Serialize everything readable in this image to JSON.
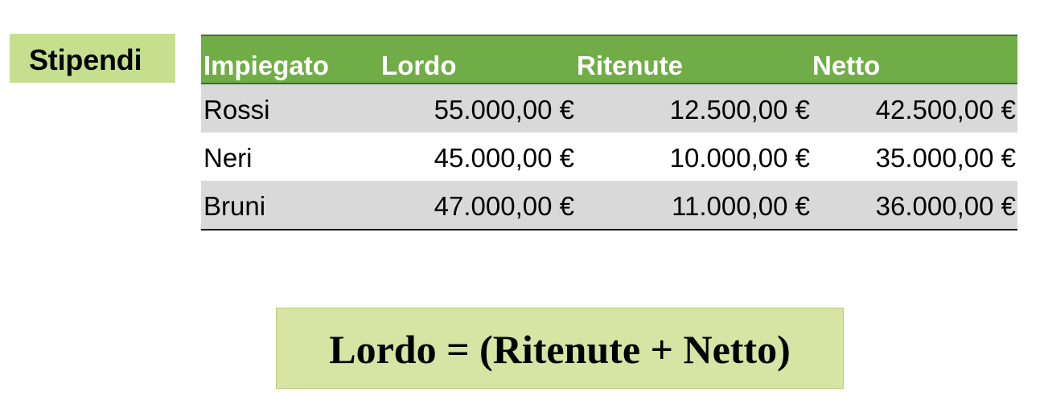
{
  "title": "Stipendi",
  "table": {
    "headers": {
      "impiegato": "Impiegato",
      "lordo": "Lordo",
      "ritenute": "Ritenute",
      "netto": "Netto"
    },
    "rows": [
      {
        "name": "Rossi",
        "lordo": "55.000,00 €",
        "ritenute": "12.500,00 €",
        "netto": "42.500,00 €"
      },
      {
        "name": "Neri",
        "lordo": "45.000,00 €",
        "ritenute": "10.000,00 €",
        "netto": "35.000,00 €"
      },
      {
        "name": "Bruni",
        "lordo": "47.000,00 €",
        "ritenute": "11.000,00 €",
        "netto": "36.000,00 €"
      }
    ]
  },
  "formula": "Lordo = (Ritenute + Netto)",
  "colors": {
    "header_green": "#70ad47",
    "title_green": "#c5df8e",
    "formula_green": "#d7e4a3",
    "row_shade": "#d9d9d9"
  }
}
